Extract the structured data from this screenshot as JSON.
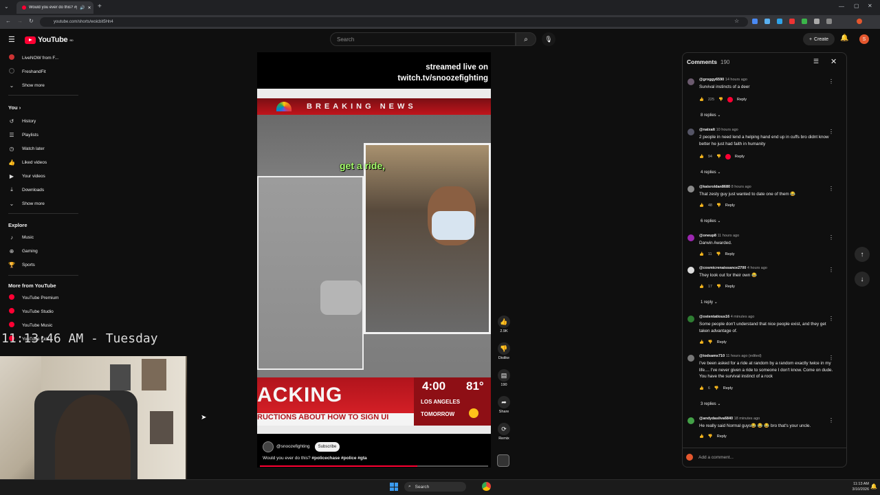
{
  "browser": {
    "tab_title": "Would you ever do this? #p",
    "url": "youtube.com/shorts/woicbit5Hn4"
  },
  "header": {
    "logo": "YouTube",
    "country": "BD",
    "search_placeholder": "Search",
    "create_label": "Create",
    "avatar_letter": "S"
  },
  "sidebar": {
    "subscriptions": [
      {
        "label": "LiveNOW from F..."
      },
      {
        "label": "FreshandFit"
      }
    ],
    "show_more_1": "Show more",
    "you_heading": "You",
    "you_items": [
      {
        "label": "History",
        "icon": "history-icon"
      },
      {
        "label": "Playlists",
        "icon": "playlists-icon"
      },
      {
        "label": "Watch later",
        "icon": "clock-icon"
      },
      {
        "label": "Liked videos",
        "icon": "thumb-up-icon"
      },
      {
        "label": "Your videos",
        "icon": "video-icon"
      },
      {
        "label": "Downloads",
        "icon": "download-icon"
      }
    ],
    "show_more_2": "Show more",
    "explore_heading": "Explore",
    "explore_items": [
      {
        "label": "Music"
      },
      {
        "label": "Gaming"
      },
      {
        "label": "Sports"
      }
    ],
    "more_heading": "More from YouTube",
    "more_items": [
      {
        "label": "YouTube Premium"
      },
      {
        "label": "YouTube Studio"
      },
      {
        "label": "YouTube Music"
      },
      {
        "label": "YouTube Kids"
      }
    ]
  },
  "overlay": {
    "clock_text": "11:13:46 AM - Tuesday"
  },
  "video": {
    "stream_line1": "streamed live on",
    "stream_line2": "twitch.tv/snoozefighting",
    "breaking": "BREAKING NEWS",
    "caption": "get a ride,",
    "lower_headline": "ACKING",
    "lower_sub": "RUCTIONS ABOUT HOW TO SIGN UI",
    "wx_time": "4:00",
    "wx_temp": "81°",
    "wx_city": "LOS ANGELES",
    "wx_tomorrow": "TOMORROW",
    "channel": "@snoozefighting",
    "subscribe": "Subscribe",
    "title_plain": "Would you ever do this? ",
    "title_tags": "#policechase #police #gta",
    "progress_fraction": 0.69
  },
  "actions": {
    "likes": "2.9K",
    "dislike": "Dislike",
    "comments": "190",
    "share": "Share",
    "remix": "Remix"
  },
  "comments_panel": {
    "title": "Comments",
    "count": "190",
    "add_placeholder": "Add a comment...",
    "items": [
      {
        "user": "@groggy6590",
        "time": "14 hours ago",
        "text": "Survival instincts of a deer",
        "likes": "225",
        "replies": "8 replies"
      },
      {
        "user": "@natxalt",
        "time": "10 hours ago",
        "text": "2 people in need lend a helping hand end up in cuffs bro didnt know better he just had faith in humanity",
        "likes": "94",
        "replies": "4 replies"
      },
      {
        "user": "@kaisroldan8680",
        "time": "8 hours ago",
        "text": "That zesty guy just wanted to date one of them 😂",
        "likes": "48",
        "replies": "6 replies"
      },
      {
        "user": "@oneup8",
        "time": "11 hours ago",
        "text": "Darwin Awarded.",
        "likes": "11",
        "replies": ""
      },
      {
        "user": "@cosmicrenaissance2700",
        "time": "4 hours ago",
        "text": "They look out for their own 😂",
        "likes": "17",
        "replies": "1 reply"
      },
      {
        "user": "@ostentatious16",
        "time": "4 minutes ago",
        "text": "Some people don't understand that nice people exist, and they get taken advantage of.",
        "likes": "",
        "replies": ""
      },
      {
        "user": "@todsams710",
        "time": "11 hours ago (edited)",
        "text": "I've been asked for a ride at random by a random exactly twice in my life.... I've never given a ride to someone I don't know. Come on dude. You have the survival instinct of a rock",
        "likes": "6",
        "replies": "3 replies"
      },
      {
        "user": "@andydasilva6840",
        "time": "18 minutes ago",
        "text": "He really said Normal guys😂 😂 😂 bro that's your uncle.",
        "likes": "",
        "replies": ""
      }
    ],
    "reply_label": "Reply"
  },
  "taskbar": {
    "search": "Search",
    "time": "11:13 AM",
    "date": "3/10/2026"
  },
  "colors": {
    "brand_red": "#ff0033",
    "news_red": "#c0141b",
    "background": "#0f0f0f"
  }
}
